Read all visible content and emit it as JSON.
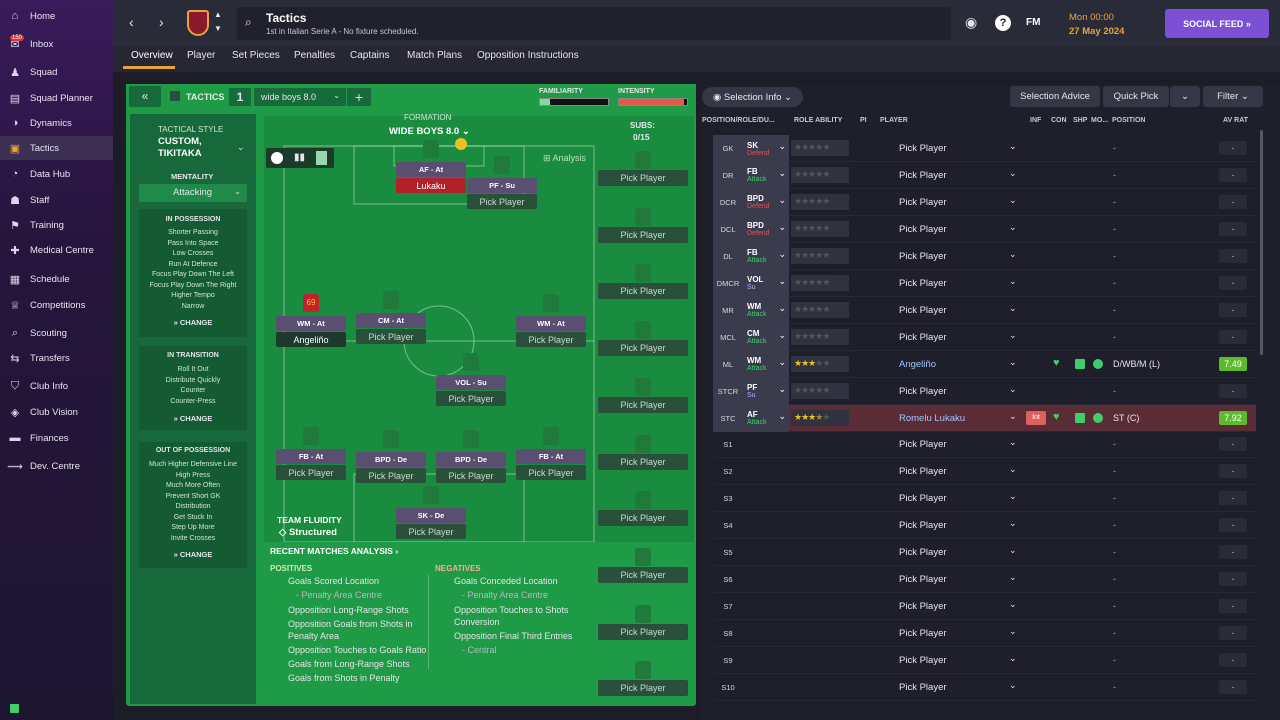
{
  "sidebar": {
    "items": [
      {
        "label": "Home",
        "icon": "home-icon"
      },
      {
        "label": "Inbox",
        "icon": "inbox-icon",
        "badge": "150"
      },
      {
        "label": "Squad",
        "icon": "shirt-icon"
      },
      {
        "label": "Squad Planner",
        "icon": "clipboard-icon"
      },
      {
        "label": "Dynamics",
        "icon": "dynamics-icon"
      },
      {
        "label": "Tactics",
        "icon": "tactics-icon"
      },
      {
        "label": "Data Hub",
        "icon": "data-icon"
      },
      {
        "label": "Staff",
        "icon": "staff-icon"
      },
      {
        "label": "Training",
        "icon": "training-icon"
      },
      {
        "label": "Medical Centre",
        "icon": "medical-icon"
      },
      {
        "label": "Schedule",
        "icon": "calendar-icon"
      },
      {
        "label": "Competitions",
        "icon": "trophy-icon"
      },
      {
        "label": "Scouting",
        "icon": "scouting-icon"
      },
      {
        "label": "Transfers",
        "icon": "transfers-icon"
      },
      {
        "label": "Club Info",
        "icon": "shield-icon"
      },
      {
        "label": "Club Vision",
        "icon": "vision-icon"
      },
      {
        "label": "Finances",
        "icon": "finance-icon"
      },
      {
        "label": "Dev. Centre",
        "icon": "dev-icon"
      }
    ]
  },
  "header": {
    "title": "Tactics",
    "subtitle": "1st in Italian Serie A - No fixture scheduled.",
    "day": "Mon 00:00",
    "date": "27 May 2024",
    "social_feed": "SOCIAL FEED",
    "fm": "FM"
  },
  "tabs": [
    "Overview",
    "Player",
    "Set Pieces",
    "Penalties",
    "Captains",
    "Match Plans",
    "Opposition Instructions"
  ],
  "tactic": {
    "header": "TACTICS",
    "slot": "1",
    "name": "wide boys 8.0",
    "familiarity": "FAMILIARITY",
    "intensity": "INTENSITY",
    "formation_label": "FORMATION",
    "formation_name": "WIDE BOYS 8.0",
    "subs_label": "SUBS:",
    "subs_count": "0/15",
    "analysis": "Analysis"
  },
  "style": {
    "label": "TACTICAL STYLE",
    "name": "CUSTOM, TIKITAKA",
    "mentality_label": "MENTALITY",
    "mentality": "Attacking",
    "in_possession": {
      "title": "IN POSSESSION",
      "items": [
        "Shorter Passing",
        "Pass Into Space",
        "Low Crosses",
        "Run At Defence",
        "Focus Play Down The Left",
        "Focus Play Down The Right",
        "Higher Tempo",
        "Narrow"
      ]
    },
    "in_transition": {
      "title": "IN TRANSITION",
      "items": [
        "Roll It Out",
        "Distribute Quickly",
        "Counter",
        "Counter-Press"
      ]
    },
    "out_of_possession": {
      "title": "OUT OF POSSESSION",
      "items": [
        "Much Higher Defensive Line",
        "High Press",
        "Much More Often",
        "Prevent Short GK",
        "Distribution",
        "Get Stuck In",
        "Step Up More",
        "Invite Crosses"
      ]
    },
    "change": "CHANGE",
    "fluidity_label": "TEAM FLUIDITY",
    "fluidity": "Structured"
  },
  "pitch_roles": [
    {
      "role": "AF - At",
      "player": "Lukaku"
    },
    {
      "role": "PF - Su",
      "player": "Pick Player"
    },
    {
      "role": "WM - At",
      "player": "Angeliño",
      "number": "69"
    },
    {
      "role": "CM - At",
      "player": "Pick Player"
    },
    {
      "role": "WM - At",
      "player": "Pick Player"
    },
    {
      "role": "VOL - Su",
      "player": "Pick Player"
    },
    {
      "role": "FB - At",
      "player": "Pick Player"
    },
    {
      "role": "BPD - De",
      "player": "Pick Player"
    },
    {
      "role": "BPD - De",
      "player": "Pick Player"
    },
    {
      "role": "FB - At",
      "player": "Pick Player"
    },
    {
      "role": "SK - De",
      "player": "Pick Player"
    }
  ],
  "sub_slots": [
    "Pick Player",
    "Pick Player",
    "Pick Player",
    "Pick Player",
    "Pick Player",
    "Pick Player",
    "Pick Player",
    "Pick Player",
    "Pick Player",
    "Pick Player"
  ],
  "recent": {
    "title": "RECENT MATCHES ANALYSIS",
    "positives_label": "POSITIVES",
    "negatives_label": "NEGATIVES",
    "positives": [
      "Goals Scored Location",
      "- Penalty Area Centre",
      "Opposition Long-Range Shots",
      "Opposition Goals from Shots in Penalty Area",
      "Opposition Touches to Goals Ratio",
      "Goals from Long-Range Shots",
      "Goals from Shots in Penalty"
    ],
    "negatives": [
      "Goals Conceded Location",
      "- Penalty Area Centre",
      "Opposition Touches to Shots Conversion",
      "Opposition Final Third Entries",
      "- Central"
    ]
  },
  "right": {
    "selection_info": "Selection Info",
    "selection_advice": "Selection Advice",
    "quick_pick": "Quick Pick",
    "filter": "Filter",
    "headers": [
      "POSITION/ROLE/DU...",
      "ROLE ABILITY",
      "PI",
      "PLAYER",
      "INF",
      "CON",
      "SHP",
      "MO...",
      "POSITION",
      "AV RAT"
    ],
    "rows": [
      {
        "pos": "GK",
        "role": "SK",
        "duty": "Defend",
        "player": "Pick Player",
        "position": "-",
        "rating": "-"
      },
      {
        "pos": "DR",
        "role": "FB",
        "duty": "Attack",
        "player": "Pick Player",
        "position": "-",
        "rating": "-"
      },
      {
        "pos": "DCR",
        "role": "BPD",
        "duty": "Defend",
        "player": "Pick Player",
        "position": "-",
        "rating": "-"
      },
      {
        "pos": "DCL",
        "role": "BPD",
        "duty": "Defend",
        "player": "Pick Player",
        "position": "-",
        "rating": "-"
      },
      {
        "pos": "DL",
        "role": "FB",
        "duty": "Attack",
        "player": "Pick Player",
        "position": "-",
        "rating": "-"
      },
      {
        "pos": "DMCR",
        "role": "VOL",
        "duty": "Su",
        "player": "Pick Player",
        "position": "-",
        "rating": "-"
      },
      {
        "pos": "MR",
        "role": "WM",
        "duty": "Attack",
        "player": "Pick Player",
        "position": "-",
        "rating": "-"
      },
      {
        "pos": "MCL",
        "role": "CM",
        "duty": "Attack",
        "player": "Pick Player",
        "position": "-",
        "rating": "-"
      },
      {
        "pos": "ML",
        "role": "WM",
        "duty": "Attack",
        "player": "Angeliño",
        "position": "D/WB/M (L)",
        "rating": "7.49",
        "stars": 3
      },
      {
        "pos": "STCR",
        "role": "PF",
        "duty": "Su",
        "player": "Pick Player",
        "position": "-",
        "rating": "-"
      },
      {
        "pos": "STC",
        "role": "AF",
        "duty": "Attack",
        "player": "Romelu Lukaku",
        "position": "ST (C)",
        "rating": "7.92",
        "stars": 3.5,
        "inf": "Int"
      },
      {
        "pos": "S1",
        "player": "Pick Player",
        "position": "-",
        "rating": "-"
      },
      {
        "pos": "S2",
        "player": "Pick Player",
        "position": "-",
        "rating": "-"
      },
      {
        "pos": "S3",
        "player": "Pick Player",
        "position": "-",
        "rating": "-"
      },
      {
        "pos": "S4",
        "player": "Pick Player",
        "position": "-",
        "rating": "-"
      },
      {
        "pos": "S5",
        "player": "Pick Player",
        "position": "-",
        "rating": "-"
      },
      {
        "pos": "S6",
        "player": "Pick Player",
        "position": "-",
        "rating": "-"
      },
      {
        "pos": "S7",
        "player": "Pick Player",
        "position": "-",
        "rating": "-"
      },
      {
        "pos": "S8",
        "player": "Pick Player",
        "position": "-",
        "rating": "-"
      },
      {
        "pos": "S9",
        "player": "Pick Player",
        "position": "-",
        "rating": "-"
      },
      {
        "pos": "S10",
        "player": "Pick Player",
        "position": "-",
        "rating": "-"
      }
    ]
  },
  "colors": {
    "accent": "#e9a23b",
    "social": "#7b4fd6",
    "pitch": "#1f9a47",
    "attack": "#3fcf6a",
    "defend": "#e05050",
    "lukaku_row": "#5a2d36",
    "rating": "#5dbb2a"
  }
}
